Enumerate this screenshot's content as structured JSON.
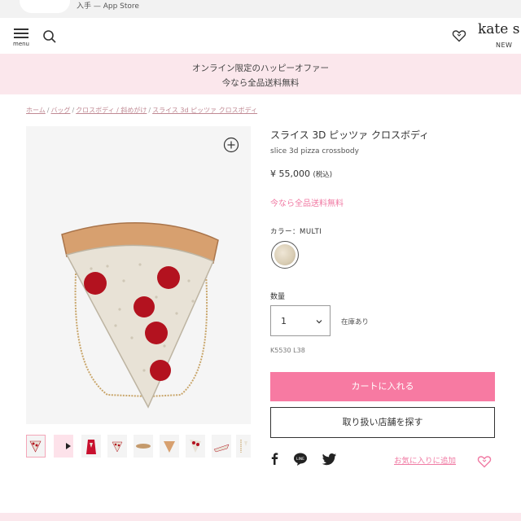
{
  "app_banner": {
    "text": "入手 — App Store"
  },
  "header": {
    "menu_label": "menu",
    "logo": "kate s",
    "new_label": "NEW"
  },
  "promo": {
    "line1": "オンライン限定のハッピーオファー",
    "line2": "今なら全品送料無料"
  },
  "breadcrumb": {
    "items": [
      "ホーム",
      "バッグ",
      "クロスボディ / 斜めがけ",
      "スライス 3d ピッツァ クロスボディ"
    ],
    "separator": "/"
  },
  "product": {
    "title_jp": "スライス 3D ピッツァ クロスボディ",
    "title_en": "slice 3d pizza crossbody",
    "price": "¥ 55,000",
    "tax_note": "(税込)",
    "shipping_note": "今なら全品送料無料",
    "color_label": "カラー：MULTI",
    "quantity_label": "数量",
    "quantity_value": "1",
    "stock_status": "在庫あり",
    "sku": "K5530 L38",
    "add_to_cart": "カートに入れる",
    "find_store": "取り扱い店舗を探す",
    "favorite_link": "お気に入りに追加"
  },
  "thumbnails": [
    {
      "name": "thumb-front",
      "active": true
    },
    {
      "name": "thumb-video",
      "active": false
    },
    {
      "name": "thumb-model",
      "active": false
    },
    {
      "name": "thumb-back",
      "active": false
    },
    {
      "name": "thumb-side",
      "active": false
    },
    {
      "name": "thumb-bottom",
      "active": false
    },
    {
      "name": "thumb-detail",
      "active": false
    },
    {
      "name": "thumb-angle",
      "active": false
    },
    {
      "name": "thumb-chain",
      "active": false
    }
  ],
  "colors": {
    "accent_pink": "#f77aa2",
    "promo_bg": "#fbe7ec",
    "link_pink": "#f07aa3"
  }
}
